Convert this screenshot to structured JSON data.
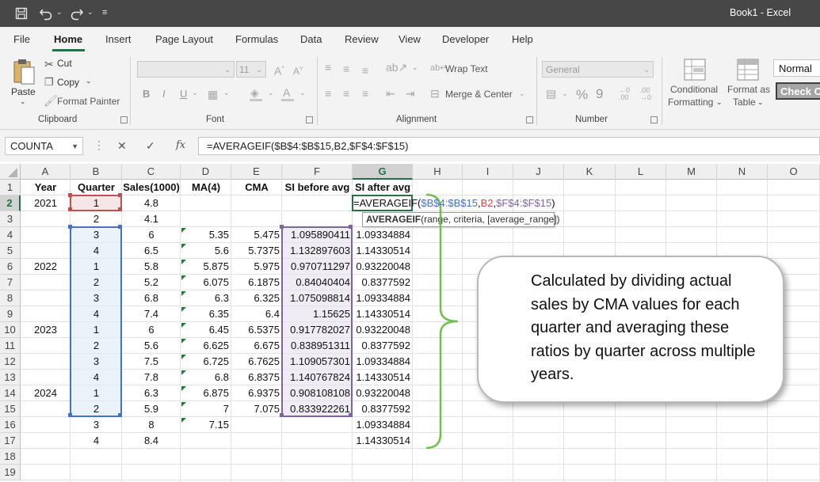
{
  "window": {
    "title": "Book1  -  Excel"
  },
  "tabs": [
    "File",
    "Home",
    "Insert",
    "Page Layout",
    "Formulas",
    "Data",
    "Review",
    "View",
    "Developer",
    "Help"
  ],
  "active_tab": "Home",
  "ribbon": {
    "clipboard": {
      "paste": "Paste",
      "cut": "Cut",
      "copy": "Copy",
      "format_painter": "Format Painter",
      "label": "Clipboard"
    },
    "font": {
      "size": "11",
      "bold": "B",
      "italic": "I",
      "underline": "U",
      "label": "Font"
    },
    "alignment": {
      "wrap_text": "Wrap Text",
      "merge_center": "Merge & Center",
      "label": "Alignment"
    },
    "number": {
      "format": "General",
      "currency": "$",
      "percent": "%",
      "comma": "9",
      "label": "Number"
    },
    "styles": {
      "conditional_1": "Conditional",
      "conditional_2": "Formatting",
      "format_as_1": "Format as",
      "format_as_2": "Table",
      "normal": "Normal",
      "check_cell": "Check Cell"
    }
  },
  "formula_bar": {
    "name_box": "COUNTA",
    "fx": "fx",
    "formula": "=AVERAGEIF($B$4:$B$15,B2,$F$4:$F$15)"
  },
  "columns": [
    "A",
    "B",
    "C",
    "D",
    "E",
    "F",
    "G",
    "H",
    "I",
    "J",
    "K",
    "L",
    "M",
    "N",
    "O"
  ],
  "rows": [
    "1",
    "2",
    "3",
    "4",
    "5",
    "6",
    "7",
    "8",
    "9",
    "10",
    "11",
    "12",
    "13",
    "14",
    "15",
    "16",
    "17",
    "18",
    "19"
  ],
  "headers": {
    "year": "Year",
    "quarter": "Quarter",
    "sales": "Sales(1000)",
    "ma": "MA(4)",
    "cma": "CMA",
    "si_before": "SI before avg",
    "si_after": "SI after avg"
  },
  "data_rows": [
    {
      "year": "2021",
      "quarter": "1",
      "sales": "4.8",
      "ma": "",
      "cma": "",
      "si_before": "",
      "si_after": ""
    },
    {
      "year": "",
      "quarter": "2",
      "sales": "4.1",
      "ma": "",
      "cma": "",
      "si_before": "",
      "si_after": ""
    },
    {
      "year": "",
      "quarter": "3",
      "sales": "6",
      "ma": "5.35",
      "cma": "5.475",
      "si_before": "1.095890411",
      "si_after": "1.09334884"
    },
    {
      "year": "",
      "quarter": "4",
      "sales": "6.5",
      "ma": "5.6",
      "cma": "5.7375",
      "si_before": "1.132897603",
      "si_after": "1.14330514"
    },
    {
      "year": "2022",
      "quarter": "1",
      "sales": "5.8",
      "ma": "5.875",
      "cma": "5.975",
      "si_before": "0.970711297",
      "si_after": "0.93220048"
    },
    {
      "year": "",
      "quarter": "2",
      "sales": "5.2",
      "ma": "6.075",
      "cma": "6.1875",
      "si_before": "0.84040404",
      "si_after": "0.8377592"
    },
    {
      "year": "",
      "quarter": "3",
      "sales": "6.8",
      "ma": "6.3",
      "cma": "6.325",
      "si_before": "1.075098814",
      "si_after": "1.09334884"
    },
    {
      "year": "",
      "quarter": "4",
      "sales": "7.4",
      "ma": "6.35",
      "cma": "6.4",
      "si_before": "1.15625",
      "si_after": "1.14330514"
    },
    {
      "year": "2023",
      "quarter": "1",
      "sales": "6",
      "ma": "6.45",
      "cma": "6.5375",
      "si_before": "0.917782027",
      "si_after": "0.93220048"
    },
    {
      "year": "",
      "quarter": "2",
      "sales": "5.6",
      "ma": "6.625",
      "cma": "6.675",
      "si_before": "0.838951311",
      "si_after": "0.8377592"
    },
    {
      "year": "",
      "quarter": "3",
      "sales": "7.5",
      "ma": "6.725",
      "cma": "6.7625",
      "si_before": "1.109057301",
      "si_after": "1.09334884"
    },
    {
      "year": "",
      "quarter": "4",
      "sales": "7.8",
      "ma": "6.8",
      "cma": "6.8375",
      "si_before": "1.140767824",
      "si_after": "1.14330514"
    },
    {
      "year": "2024",
      "quarter": "1",
      "sales": "6.3",
      "ma": "6.875",
      "cma": "6.9375",
      "si_before": "0.908108108",
      "si_after": "0.93220048"
    },
    {
      "year": "",
      "quarter": "2",
      "sales": "5.9",
      "ma": "7",
      "cma": "7.075",
      "si_before": "0.833922261",
      "si_after": "0.8377592"
    },
    {
      "year": "",
      "quarter": "3",
      "sales": "8",
      "ma": "7.15",
      "cma": "",
      "si_before": "",
      "si_after": "1.09334884"
    },
    {
      "year": "",
      "quarter": "4",
      "sales": "8.4",
      "ma": "",
      "cma": "",
      "si_before": "",
      "si_after": "1.14330514"
    }
  ],
  "editing": {
    "prefix": "=AVERAGEIF(",
    "arg1": "$B$4:$B$15",
    "sep1": ",",
    "arg2": "B2",
    "sep2": ",",
    "arg3": "$F$4:$F$15",
    "suffix": ")"
  },
  "tooltip": {
    "func": "AVERAGEIF",
    "args": "(range, criteria, [average_range])"
  },
  "callout": {
    "text": "Calculated by dividing actual sales by CMA values for each quarter and averaging these ratios by quarter across multiple years."
  },
  "colors": {
    "excel_green": "#217346",
    "range_blue": "#4472c4",
    "range_red": "#c0504d",
    "range_purple": "#8064a2",
    "brace_green": "#70c050"
  }
}
